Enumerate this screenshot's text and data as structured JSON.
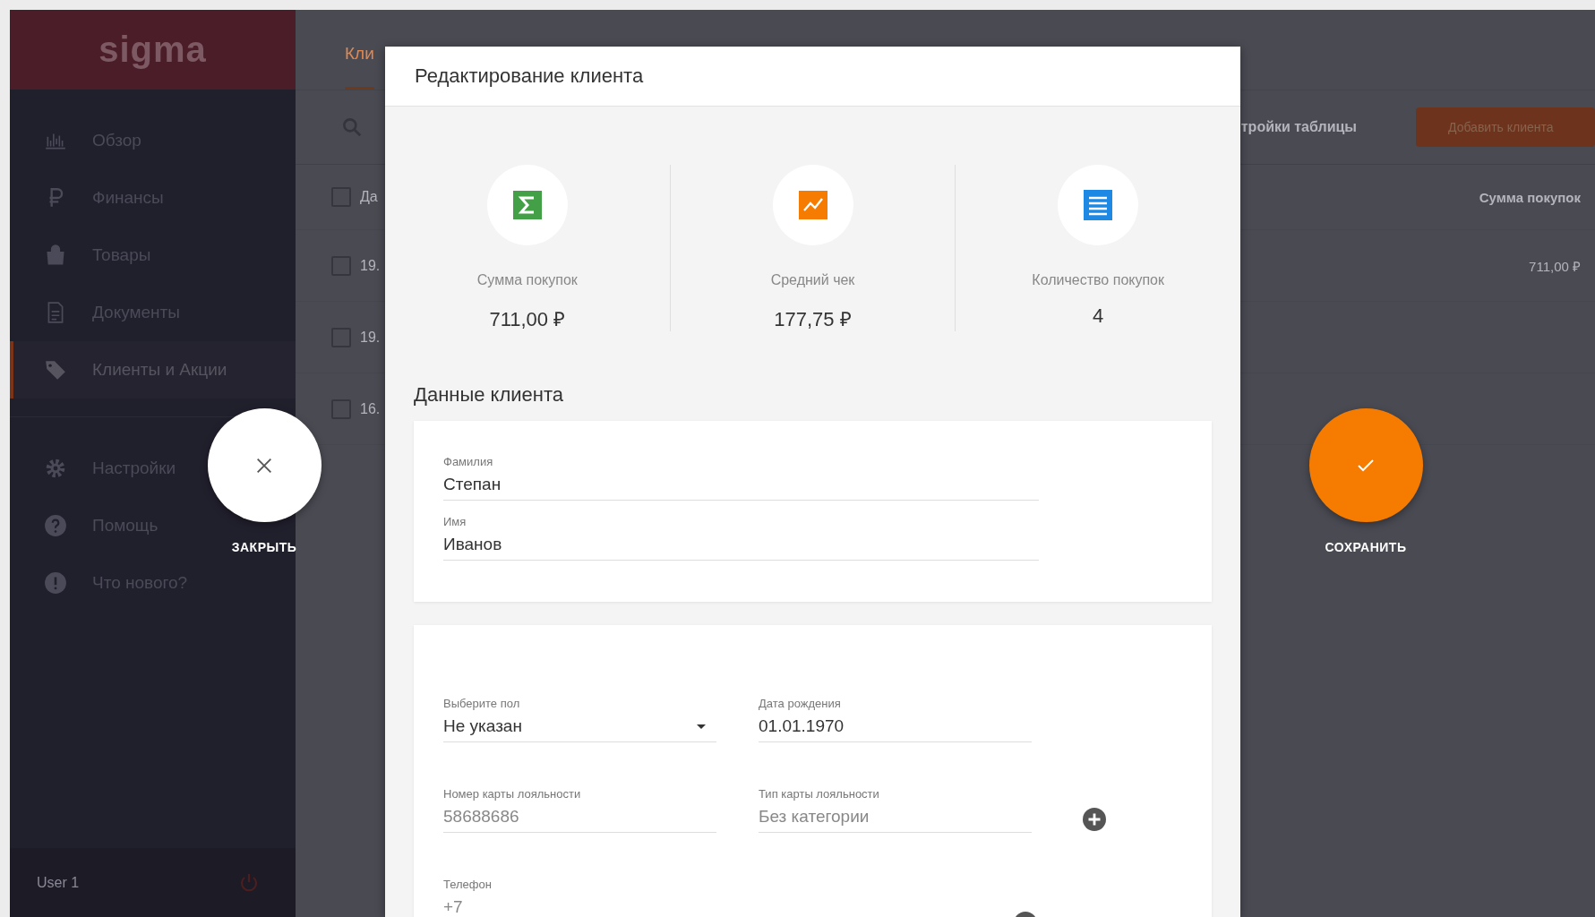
{
  "sidebar": {
    "logo": "sigma",
    "items": [
      {
        "label": "Обзор",
        "selected": false
      },
      {
        "label": "Финансы",
        "selected": false
      },
      {
        "label": "Товары",
        "selected": false
      },
      {
        "label": "Документы",
        "selected": false
      },
      {
        "label": "Клиенты и Акции",
        "selected": true
      }
    ],
    "secondary_items": [
      {
        "label": "Настройки"
      },
      {
        "label": "Помощь"
      },
      {
        "label": "Что нового?"
      }
    ],
    "user": "User 1"
  },
  "tabs": [
    {
      "label": "Кли",
      "selected": true
    }
  ],
  "toolbar": {
    "settings_link": "тройки таблицы",
    "add_button": "Добавить клиента"
  },
  "table": {
    "header": {
      "column_1": "Да",
      "column_2": "Сумма покупок",
      "checked": false
    },
    "rows": [
      {
        "column_1": "19.",
        "column_2": "711,00 ₽",
        "checked": false
      },
      {
        "column_1": "19.",
        "checked": false
      },
      {
        "column_1": "16.",
        "checked": false
      }
    ]
  },
  "close_button": {
    "label": "ЗАКРЫТЬ"
  },
  "save_button": {
    "label": "СОХРАНИТЬ"
  },
  "dialog": {
    "title": "Редактирование клиента",
    "stats": [
      {
        "kind": "sum",
        "label": "Сумма покупок",
        "value": "711,00 ₽"
      },
      {
        "kind": "average",
        "label": "Средний чек",
        "value": "177,75 ₽"
      },
      {
        "kind": "count",
        "label": "Количество покупок",
        "value": "4"
      }
    ],
    "section_title": "Данные клиента",
    "name_fields": [
      {
        "label": "Фамилия",
        "value": "Степан"
      },
      {
        "label": "Имя",
        "value": "Иванов"
      }
    ],
    "gender": {
      "label": "Выберите пол",
      "value": "Не указан"
    },
    "birth_date": {
      "label": "Дата рождения",
      "value": "01.01.1970"
    },
    "card_number": {
      "label": "Номер карты лояльности",
      "placeholder": "58688686"
    },
    "card_type": {
      "label": "Тип карты лояльности",
      "placeholder": "Без категории"
    },
    "phone": {
      "label": "Телефон",
      "placeholder": "+7"
    }
  }
}
